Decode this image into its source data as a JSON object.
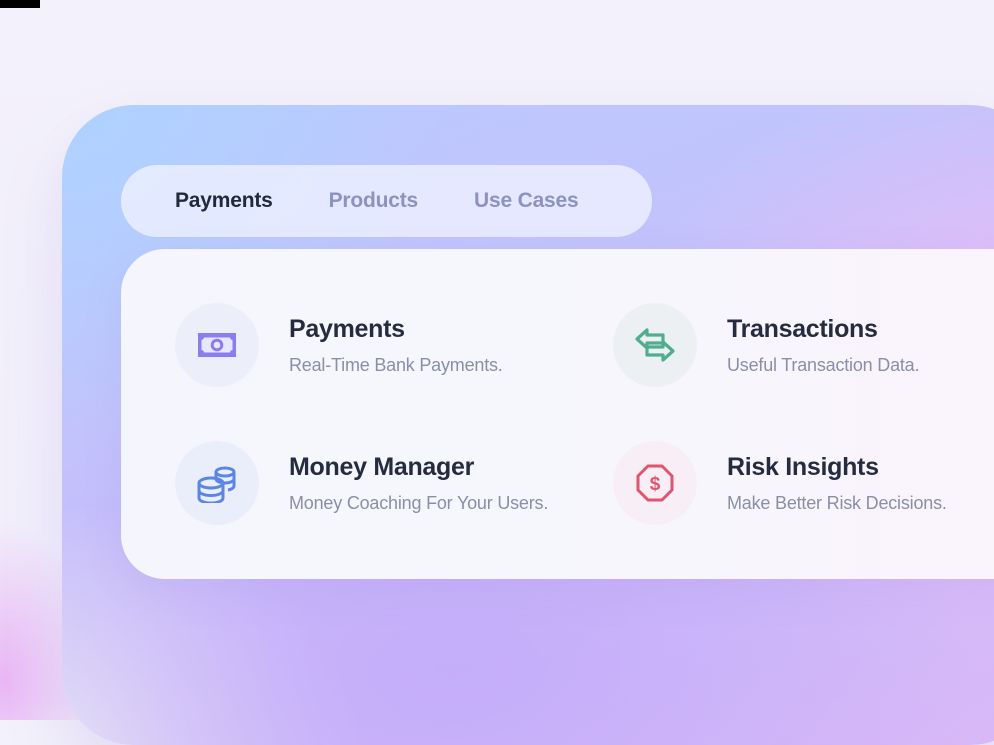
{
  "tabs": [
    {
      "label": "Payments",
      "active": true
    },
    {
      "label": "Products",
      "active": false
    },
    {
      "label": "Use Cases",
      "active": false
    }
  ],
  "items": [
    {
      "title": "Payments",
      "description": "Real-Time Bank Payments.",
      "icon": "banknote-icon",
      "icon_color": "#8b7cf0",
      "icon_bg": "#eceef9"
    },
    {
      "title": "Transactions",
      "description": "Useful Transaction Data.",
      "icon": "exchange-arrows-icon",
      "icon_color": "#4fae8e",
      "icon_bg": "#ecf0f3"
    },
    {
      "title": "Money Manager",
      "description": "Money Coaching For Your Users.",
      "icon": "coins-stack-icon",
      "icon_color": "#5b86e8",
      "icon_bg": "#eaeefa"
    },
    {
      "title": "Risk Insights",
      "description": "Make Better Risk Decisions.",
      "icon": "dollar-octagon-icon",
      "icon_color": "#e2546e",
      "icon_bg": "#f8eef6"
    }
  ]
}
